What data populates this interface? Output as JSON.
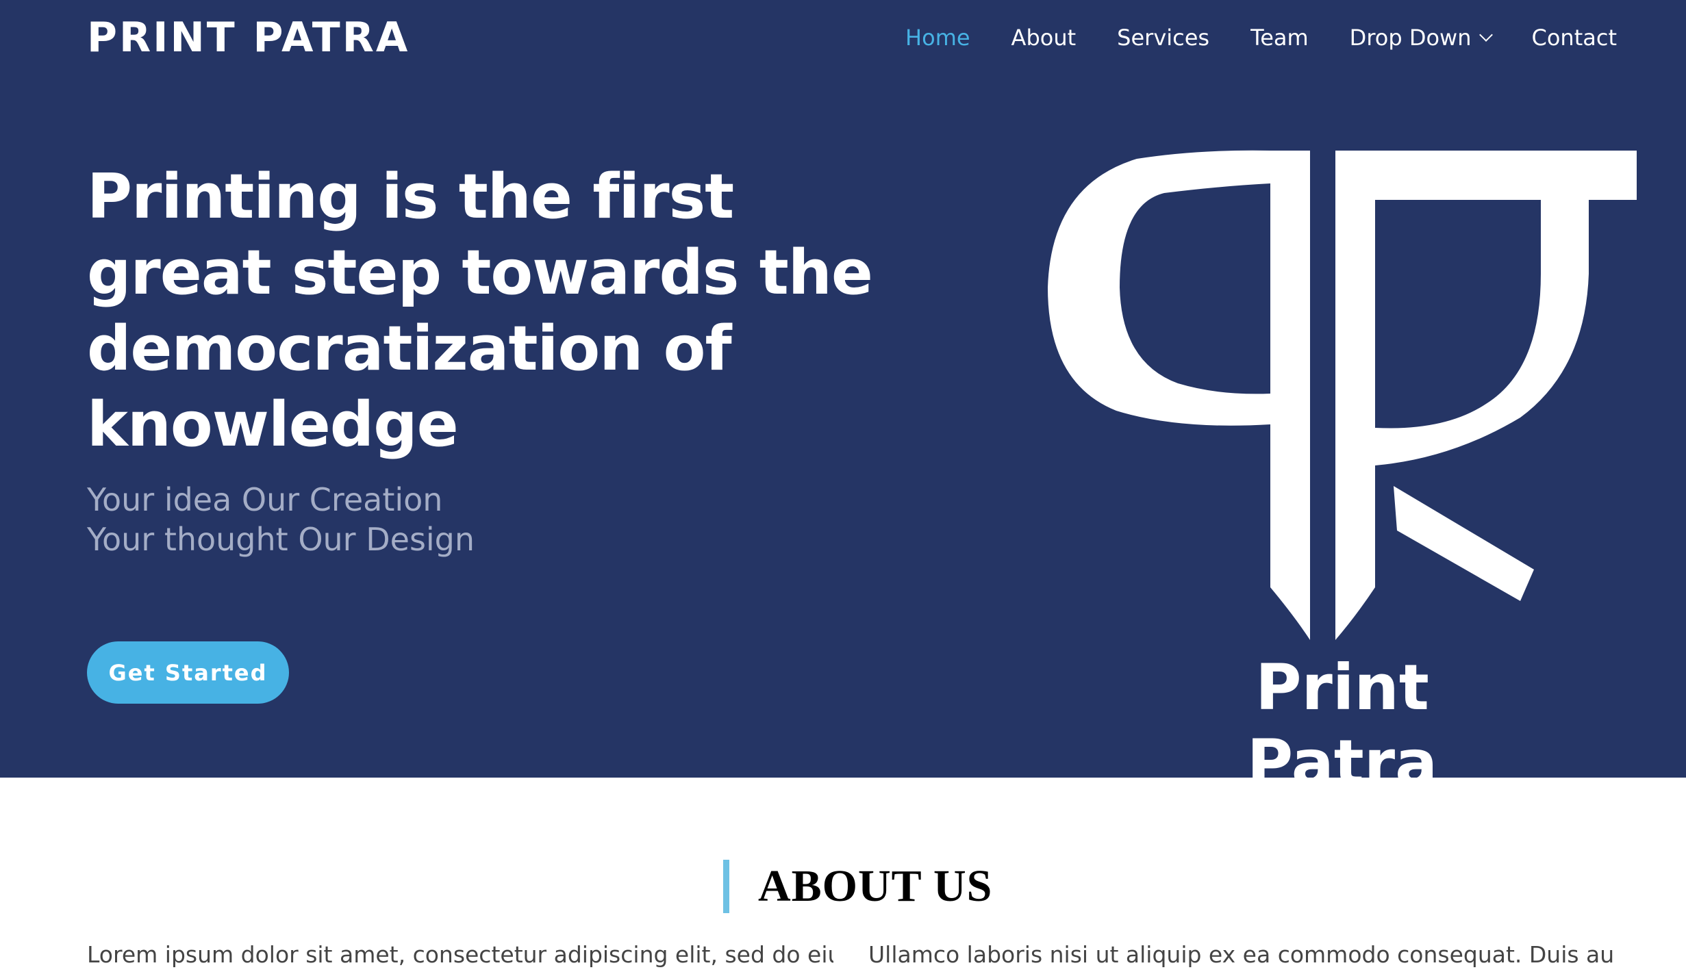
{
  "header": {
    "logo": "PRINT PATRA",
    "nav": [
      {
        "label": "Home",
        "active": true
      },
      {
        "label": "About",
        "active": false
      },
      {
        "label": "Services",
        "active": false
      },
      {
        "label": "Team",
        "active": false
      },
      {
        "label": "Drop Down",
        "active": false,
        "dropdown": true
      },
      {
        "label": "Contact",
        "active": false
      }
    ]
  },
  "hero": {
    "headline": "Printing is the first great step towards the democratization of knowledge",
    "subline_1": "Your idea Our Creation",
    "subline_2": "Your thought Our Design",
    "cta_label": "Get Started",
    "brand_name": "Print Patra",
    "brand_icon": "print-patra-logo-icon"
  },
  "about": {
    "title": "ABOUT US",
    "left_text": "Lorem ipsum dolor sit amet, consectetur adipiscing elit, sed do eiusmod",
    "right_text": "Ullamco laboris nisi ut aliquip ex ea commodo consequat. Duis aute irure"
  },
  "colors": {
    "hero_bg": "#253565",
    "accent": "#47b2e4",
    "about_bar": "#6ec1e4",
    "subtitle": "#a4adc6"
  }
}
